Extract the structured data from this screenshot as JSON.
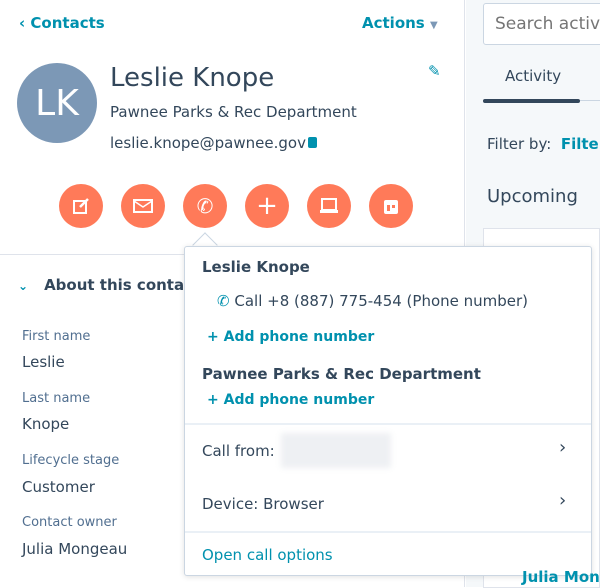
{
  "header": {
    "back_label": "Contacts",
    "actions_label": "Actions"
  },
  "contact": {
    "initials": "LK",
    "name": "Leslie Knope",
    "company": "Pawnee Parks & Rec Department",
    "email": "leslie.knope@pawnee.gov"
  },
  "action_buttons": [
    {
      "icon": "note-icon"
    },
    {
      "icon": "email-icon"
    },
    {
      "icon": "phone-icon"
    },
    {
      "icon": "plus-icon"
    },
    {
      "icon": "task-icon"
    },
    {
      "icon": "calendar-icon"
    }
  ],
  "about": {
    "title": "About this contact",
    "fields": [
      {
        "label": "First name",
        "value": "Leslie"
      },
      {
        "label": "Last name",
        "value": "Knope"
      },
      {
        "label": "Lifecycle stage",
        "value": "Customer"
      },
      {
        "label": "Contact owner",
        "value": "Julia Mongeau"
      }
    ]
  },
  "right": {
    "search_placeholder": "Search activit",
    "tab": "Activity",
    "filter_label": "Filter by:",
    "filter_link": "Filter",
    "upcoming": "Upcoming",
    "owner_partial": "Julia Mong"
  },
  "call_popover": {
    "contact_name": "Leslie Knope",
    "call_label": "Call +8 (887) 775-454 (Phone number)",
    "add_phone": "+ Add phone number",
    "company_name": "Pawnee Parks & Rec Department",
    "add_phone_company": "+ Add phone number",
    "call_from": "Call from:",
    "device": "Device: Browser",
    "open_options": "Open call options"
  },
  "colors": {
    "accent": "#0091ae",
    "button": "#ff7a59",
    "avatar": "#7c98b6"
  }
}
